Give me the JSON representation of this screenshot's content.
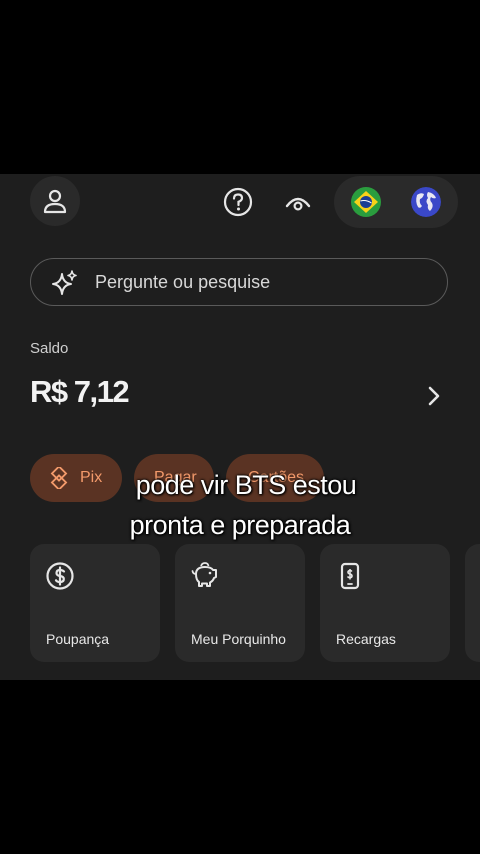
{
  "search": {
    "placeholder": "Pergunte ou pesquise"
  },
  "balance": {
    "label": "Saldo",
    "value": "R$ 7,12"
  },
  "quick_actions": [
    {
      "label": "Pix",
      "icon": "pix-icon"
    },
    {
      "label": "Pagar",
      "icon": ""
    },
    {
      "label": "Cartões",
      "icon": ""
    }
  ],
  "cards": [
    {
      "label": "Poupança",
      "icon": "dollar-coin-icon"
    },
    {
      "label": "Meu Porquinho",
      "icon": "piggy-bank-icon"
    },
    {
      "label": "Recargas",
      "icon": "phone-icon"
    }
  ],
  "caption": {
    "line1": "pode vir BTS estou",
    "line2": "pronta e preparada"
  },
  "colors": {
    "background": "#1e1e1e",
    "accent": "#f39a6b",
    "pill_bg": "#5a3323",
    "card_bg": "#2a2a2a"
  }
}
